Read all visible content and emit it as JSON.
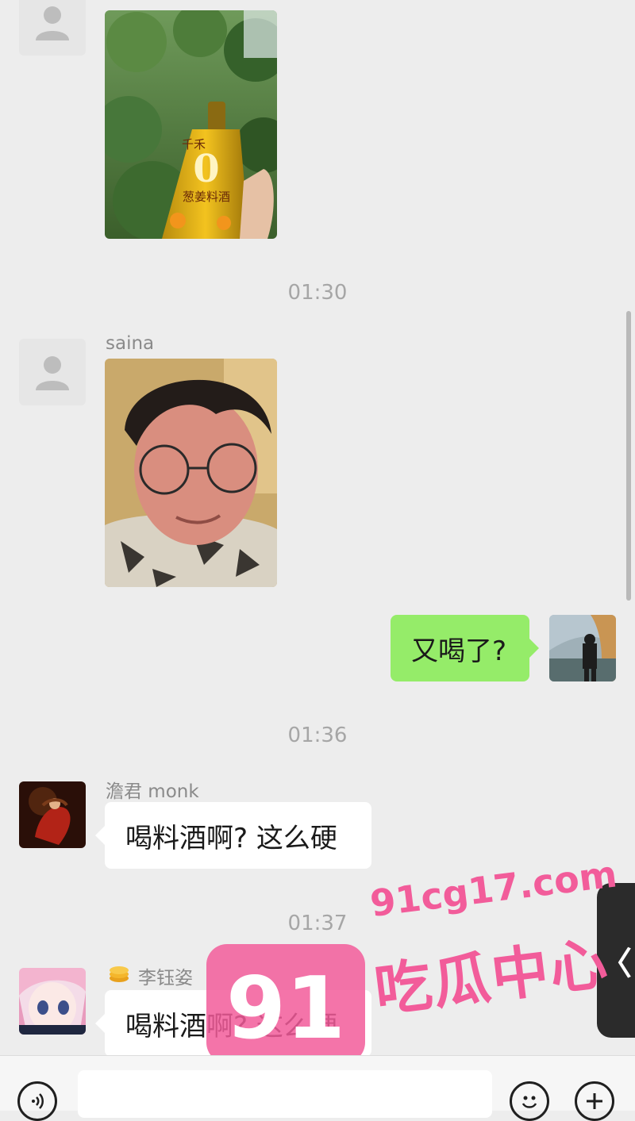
{
  "messages": {
    "m1": {
      "sender": "saina"
    },
    "t1": {
      "time": "01:30"
    },
    "m2": {
      "sender": "saina"
    },
    "m3": {
      "text": "又喝了?"
    },
    "t2": {
      "time": "01:36"
    },
    "m4": {
      "sender": "澹君 monk",
      "text": "喝料酒啊? 这么硬"
    },
    "t3": {
      "time": "01:37"
    },
    "m5": {
      "sender": "李钰姿",
      "text": "喝料酒啊? 这么硬"
    }
  },
  "photo1": {
    "bottle_number": "0",
    "bottle_label": "葱姜料酒",
    "bottle_brand": "千禾"
  },
  "watermark": {
    "logo_number": "91",
    "site": "91cg17.com",
    "name": "吃瓜中心"
  },
  "side_tab": {
    "glyph": "〈"
  },
  "bottom_bar": {
    "voice_icon": "voice-icon",
    "emoji_icon": "emoji-icon",
    "plus_icon": "plus-icon"
  },
  "colors": {
    "background": "#ededed",
    "self_bubble": "#95ec69",
    "other_bubble": "#ffffff",
    "watermark": "#f25c9a"
  }
}
